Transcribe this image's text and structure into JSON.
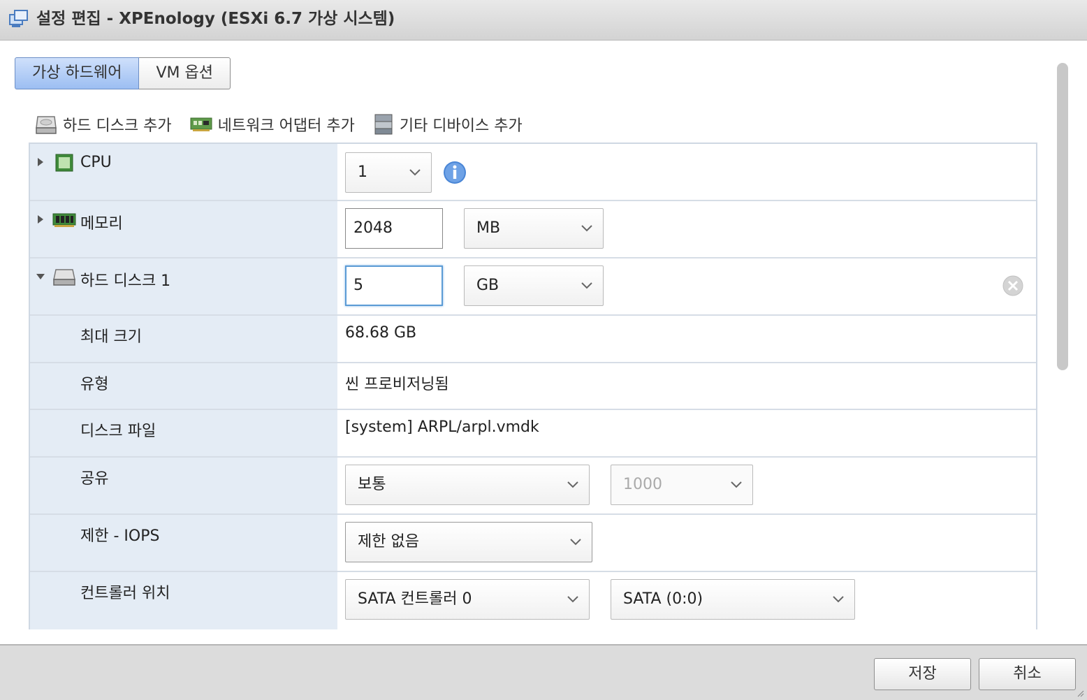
{
  "window": {
    "title": "설정 편집 - XPEnology (ESXi 6.7 가상 시스템)"
  },
  "tabs": [
    {
      "label": "가상 하드웨어",
      "active": true
    },
    {
      "label": "VM 옵션",
      "active": false
    }
  ],
  "toolbar": {
    "add_hard_disk": "하드 디스크 추가",
    "add_network_adapter": "네트워크 어댑터 추가",
    "add_other_device": "기타 디바이스 추가"
  },
  "hardware": {
    "cpu": {
      "label": "CPU",
      "value": "1"
    },
    "memory": {
      "label": "메모리",
      "value": "2048",
      "unit": "MB"
    },
    "hard_disk": {
      "label": "하드 디스크 1",
      "size": "5",
      "unit": "GB",
      "max_size_label": "최대 크기",
      "max_size_value": "68.68 GB",
      "type_label": "유형",
      "type_value": "씬 프로비저닝됨",
      "disk_file_label": "디스크 파일",
      "disk_file_value": "[system] ARPL/arpl.vmdk",
      "shares_label": "공유",
      "shares_level": "보통",
      "shares_value": "1000",
      "limit_label": "제한 - IOPS",
      "limit_value": "제한 없음",
      "controller_label": "컨트롤러 위치",
      "controller_value": "SATA 컨트롤러 0",
      "controller_slot": "SATA (0:0)"
    }
  },
  "footer": {
    "save": "저장",
    "cancel": "취소"
  },
  "colors": {
    "tab_active": "#9cbef2",
    "label_bg": "#e4ecf5",
    "focus": "#5b9bd5",
    "info": "#4a86d6"
  }
}
